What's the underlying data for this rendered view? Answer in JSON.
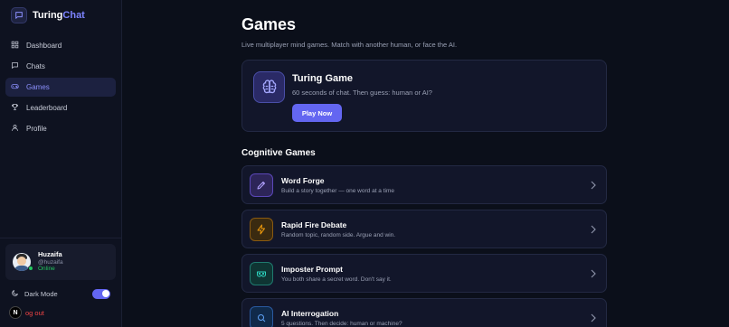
{
  "brand": {
    "name_main": "Turing",
    "name_accent": "Chat"
  },
  "sidebar": {
    "items": [
      {
        "label": "Dashboard",
        "icon": "grid-icon",
        "active": false
      },
      {
        "label": "Chats",
        "icon": "chat-icon",
        "active": false
      },
      {
        "label": "Games",
        "icon": "gamepad-icon",
        "active": true
      },
      {
        "label": "Leaderboard",
        "icon": "trophy-icon",
        "active": false
      },
      {
        "label": "Profile",
        "icon": "user-icon",
        "active": false
      }
    ],
    "user": {
      "name": "Huzaifa",
      "handle": "@huzaifa",
      "status": "Online"
    },
    "dark_mode_label": "Dark Mode",
    "dark_mode_on": true,
    "logout_badge": "N",
    "logout_label": "og out"
  },
  "main": {
    "title": "Games",
    "subtitle": "Live multiplayer mind games. Match with another human, or face the AI.",
    "featured": {
      "title": "Turing Game",
      "description": "60 seconds of chat. Then guess: human or AI?",
      "button_label": "Play Now",
      "icon": "brain-icon"
    },
    "section_title": "Cognitive Games",
    "games": [
      {
        "title": "Word Forge",
        "description": "Build a story together — one word at a time",
        "icon": "pencil-icon",
        "color": "#7c5cff"
      },
      {
        "title": "Rapid Fire Debate",
        "description": "Random topic, random side. Argue and win.",
        "icon": "lightning-icon",
        "color": "#f59e0b"
      },
      {
        "title": "Imposter Prompt",
        "description": "You both share a secret word. Don't say it.",
        "icon": "mask-icon",
        "color": "#14b8a6"
      },
      {
        "title": "AI Interrogation",
        "description": "5 questions. Then decide: human or machine?",
        "icon": "search-icon",
        "color": "#3b82f6"
      }
    ]
  },
  "colors": {
    "accent": "#6366f1",
    "online": "#22c55e",
    "logout": "#ef4444"
  }
}
